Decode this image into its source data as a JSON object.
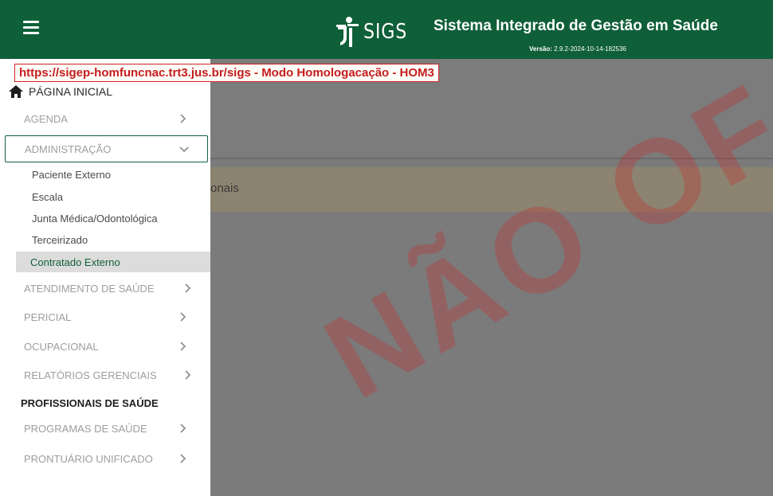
{
  "header": {
    "logo_text": "SIGS",
    "system_title": "Sistema Integrado de Gestão em Saúde",
    "version_label": "Versão:",
    "version_value": "2.9.2-2024-10-14-182536",
    "background_color": "#0f5f38"
  },
  "environment_banner": "https://sigep-homfuncnac.trt3.jus.br/sigs - Modo Homologacação - HOM3",
  "sidebar": {
    "home_label": "PÁGINA INICIAL",
    "items": [
      {
        "label": "AGENDA",
        "chevron": "chevron-right"
      },
      {
        "label": "ADMINISTRAÇÃO",
        "chevron": "chevron-down",
        "expanded": true
      },
      {
        "label": "ATENDIMENTO DE SAÚDE",
        "chevron": "chevron-right"
      },
      {
        "label": "PERICIAL",
        "chevron": "chevron-right"
      },
      {
        "label": "OCUPACIONAL",
        "chevron": "chevron-right"
      },
      {
        "label": "RELATÓRIOS GERENCIAIS",
        "chevron": "chevron-right"
      },
      {
        "label": "PROFISSIONAIS DE SAÚDE"
      },
      {
        "label": "PROGRAMAS DE SAÚDE",
        "chevron": "chevron-right"
      },
      {
        "label": "PRONTUÁRIO UNIFICADO",
        "chevron": "chevron-right"
      }
    ],
    "admin_subitems": [
      {
        "label": "Paciente Externo"
      },
      {
        "label": "Escala"
      },
      {
        "label": "Junta Médica/Odontológica"
      },
      {
        "label": "Terceirizado"
      },
      {
        "label": "Contratado Externo",
        "selected": true
      }
    ]
  },
  "background": {
    "notice_fragment": "onais",
    "watermark": "NÃO OF"
  }
}
